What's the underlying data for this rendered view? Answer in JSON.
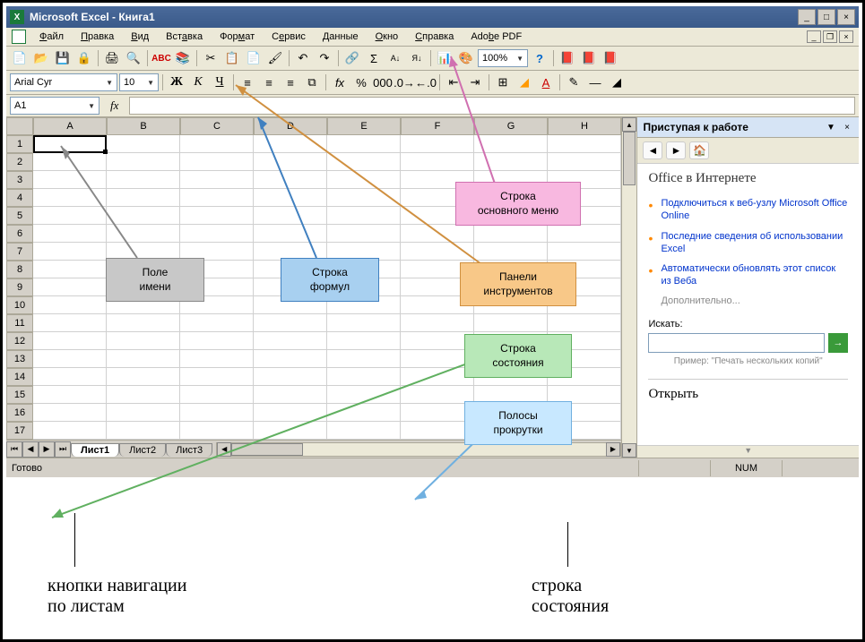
{
  "titlebar": {
    "text": "Microsoft Excel - Книга1"
  },
  "menu": {
    "items": [
      "Файл",
      "Правка",
      "Вид",
      "Вставка",
      "Формат",
      "Сервис",
      "Данные",
      "Окно",
      "Справка",
      "Adobe PDF"
    ]
  },
  "toolbar": {
    "zoom": "100%"
  },
  "format": {
    "font": "Arial Cyr",
    "size": "10",
    "bold": "Ж",
    "italic": "К",
    "underline": "Ч",
    "fx": "fx",
    "pct": "%"
  },
  "namebox": {
    "ref": "A1",
    "fx": "fx"
  },
  "columns": [
    "A",
    "B",
    "C",
    "D",
    "E",
    "F",
    "G",
    "H"
  ],
  "rows": [
    "1",
    "2",
    "3",
    "4",
    "5",
    "6",
    "7",
    "8",
    "9",
    "10",
    "11",
    "12",
    "13",
    "14",
    "15",
    "16",
    "17"
  ],
  "sheets": {
    "tabs": [
      "Лист1",
      "Лист2",
      "Лист3"
    ]
  },
  "taskpane": {
    "title": "Приступая к работе",
    "h1": "Office в Интернете",
    "links": [
      "Подключиться к веб-узлу Microsoft Office Online",
      "Последние сведения об использовании Excel",
      "Автоматически обновлять этот список из Веба"
    ],
    "extra": "Дополнительно...",
    "search_label": "Искать:",
    "example": "Пример:  \"Печать нескольких копий\"",
    "open": "Открыть"
  },
  "status": {
    "ready": "Готово",
    "num": "NUM"
  },
  "callouts": {
    "name_field": "Поле\nимени",
    "formula_bar": "Строка\nформул",
    "main_menu": "Строка\nосновного меню",
    "toolbars": "Панели\nинструментов",
    "status_bar_c": "Строка\nсостояния",
    "scrollbars": "Полосы\nпрокрутки"
  },
  "bottom_labels": {
    "nav": "кнопки навигации\nпо листам",
    "status": "строка\nсостояния"
  }
}
